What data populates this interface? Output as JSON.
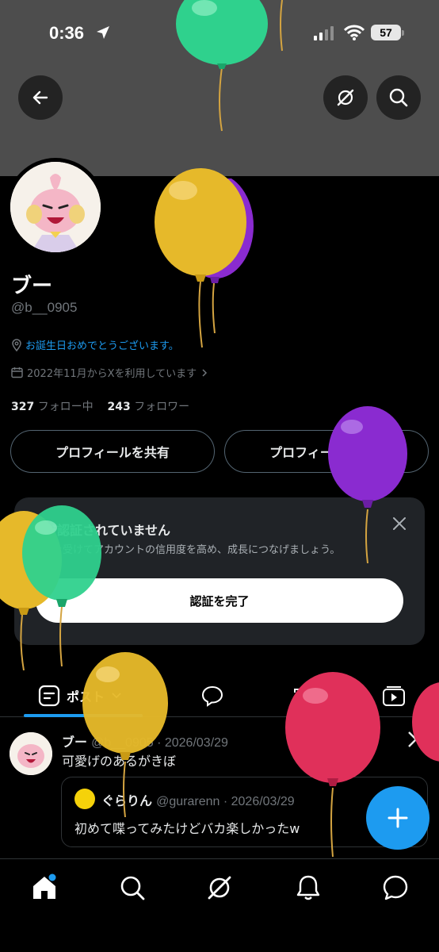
{
  "status_bar": {
    "time": "0:36",
    "battery": "57"
  },
  "profile": {
    "display_name": "ブー",
    "handle": "@b__0905",
    "bio": "お誕生日おめでとうございます。",
    "joined": "2022年11月からXを利用しています",
    "following_count": "327",
    "following_label": "フォロー中",
    "followers_count": "243",
    "followers_label": "フォロワー"
  },
  "actions": {
    "share_label": "プロフィールを共有",
    "edit_label": "プロフィールを編集"
  },
  "verify_card": {
    "title": "まだ認証されていません",
    "description": "認証を受けてアカウントの信用度を高め、成長につなげましょう。",
    "button_label": "認証を完了"
  },
  "tabs": {
    "posts_label": "ポスト"
  },
  "post": {
    "name": "ブー",
    "meta": "@b__0905 · 2026/03/29",
    "text": "可愛げのあるがきぼ",
    "quote": {
      "name": "ぐらりん",
      "meta": "@gurarenn · 2026/03/29",
      "text": "初めて喋ってみたけどバカ楽しかったw"
    }
  },
  "icons": {
    "back": "back-arrow-icon",
    "grok": "grok-icon",
    "search": "search-icon",
    "location": "location-icon",
    "calendar": "calendar-icon",
    "close": "close-icon",
    "compose": "plus-icon"
  },
  "colors": {
    "accent": "#1d9bf0",
    "balloon_green": "#2fd18d",
    "balloon_yellow": "#e6b92a",
    "balloon_purple": "#8a2bd0",
    "balloon_red": "#e0305a"
  }
}
